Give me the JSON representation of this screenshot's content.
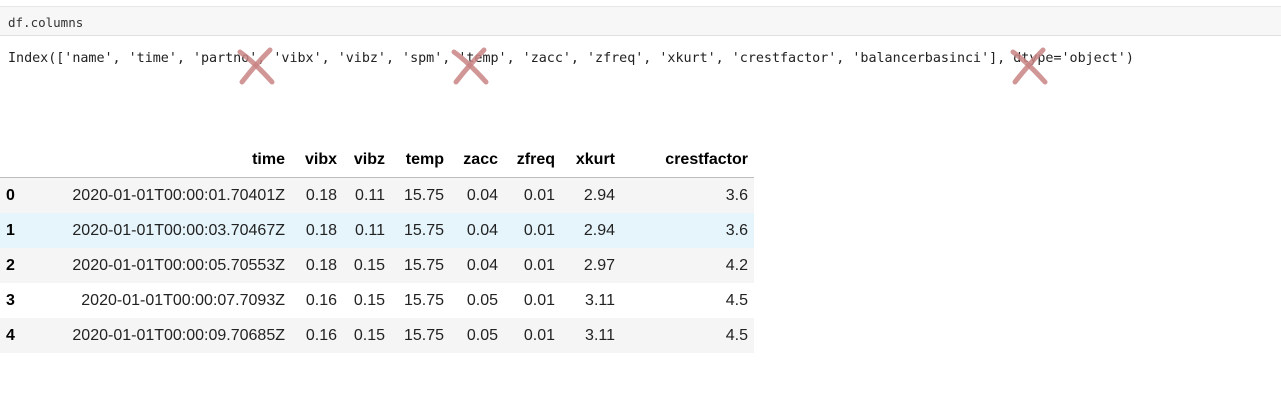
{
  "input_cell": {
    "code": "df.columns"
  },
  "output": {
    "index_text": "Index(['name', 'time', 'partno', 'vibx', 'vibz', 'spm', 'temp', 'zacc', 'zfreq', 'xkurt', 'crestfactor', 'balancerbasinci'], dtype='object')"
  },
  "annotations": {
    "cross_mark_color": "#d08080",
    "crossed_out_columns": [
      "partno",
      "spm",
      "balancerbasinci"
    ]
  },
  "dataframe": {
    "columns": [
      "",
      "time",
      "vibx",
      "vibz",
      "temp",
      "zacc",
      "zfreq",
      "xkurt",
      "crestfactor"
    ],
    "rows": [
      {
        "index": "0",
        "time": "2020-01-01T00:00:01.70401Z",
        "vibx": "0.18",
        "vibz": "0.11",
        "temp": "15.75",
        "zacc": "0.04",
        "zfreq": "0.01",
        "xkurt": "2.94",
        "crestfactor": "3.6"
      },
      {
        "index": "1",
        "time": "2020-01-01T00:00:03.70467Z",
        "vibx": "0.18",
        "vibz": "0.11",
        "temp": "15.75",
        "zacc": "0.04",
        "zfreq": "0.01",
        "xkurt": "2.94",
        "crestfactor": "3.6"
      },
      {
        "index": "2",
        "time": "2020-01-01T00:00:05.70553Z",
        "vibx": "0.18",
        "vibz": "0.15",
        "temp": "15.75",
        "zacc": "0.04",
        "zfreq": "0.01",
        "xkurt": "2.97",
        "crestfactor": "4.2"
      },
      {
        "index": "3",
        "time": "2020-01-01T00:00:07.7093Z",
        "vibx": "0.16",
        "vibz": "0.15",
        "temp": "15.75",
        "zacc": "0.05",
        "zfreq": "0.01",
        "xkurt": "3.11",
        "crestfactor": "4.5"
      },
      {
        "index": "4",
        "time": "2020-01-01T00:00:09.70685Z",
        "vibx": "0.16",
        "vibz": "0.15",
        "temp": "15.75",
        "zacc": "0.05",
        "zfreq": "0.01",
        "xkurt": "3.11",
        "crestfactor": "4.5"
      }
    ]
  }
}
